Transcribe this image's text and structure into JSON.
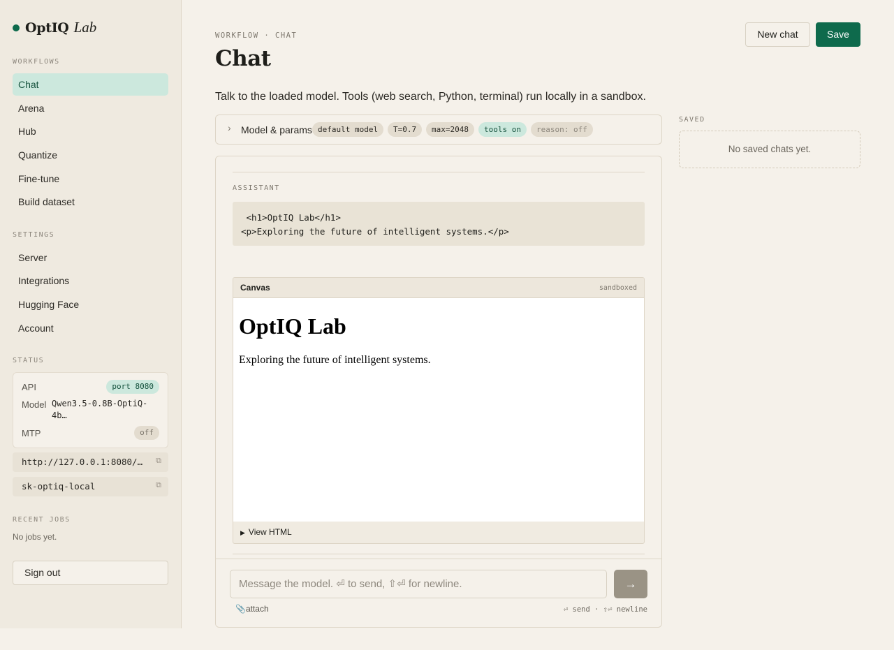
{
  "brand": {
    "name": "OptIQ",
    "suffix": "Lab"
  },
  "sidebar": {
    "workflows_label": "WORKFLOWS",
    "workflows": [
      {
        "label": "Chat"
      },
      {
        "label": "Arena"
      },
      {
        "label": "Hub"
      },
      {
        "label": "Quantize"
      },
      {
        "label": "Fine-tune"
      },
      {
        "label": "Build dataset"
      }
    ],
    "settings_label": "SETTINGS",
    "settings": [
      {
        "label": "Server"
      },
      {
        "label": "Integrations"
      },
      {
        "label": "Hugging Face"
      },
      {
        "label": "Account"
      }
    ],
    "status_label": "STATUS",
    "status": {
      "api_label": "API",
      "api_value": "port 8080",
      "model_label": "Model",
      "model_value": "Qwen3.5-0.8B-OptiQ-4b…",
      "mtp_label": "MTP",
      "mtp_value": "off"
    },
    "endpoint": "http://127.0.0.1:8080/…",
    "api_key": "sk-optiq-local",
    "recent_jobs_label": "RECENT JOBS",
    "recent_jobs_empty": "No jobs yet.",
    "sign_out": "Sign out"
  },
  "header": {
    "breadcrumb": "WORKFLOW · CHAT",
    "title": "Chat",
    "new_chat": "New chat",
    "save": "Save",
    "description": "Talk to the loaded model. Tools (web search, Python, terminal) run locally in a sandbox."
  },
  "params": {
    "chevron": "›",
    "label": "Model & params",
    "tags": [
      "default model",
      "T=0.7",
      "max=2048",
      "tools on",
      "reason: off"
    ]
  },
  "saved": {
    "label": "SAVED",
    "empty": "No saved chats yet."
  },
  "message": {
    "role": "ASSISTANT",
    "code_line1": " <h1>OptIQ Lab</h1>",
    "code_line2": "<p>Exploring the future of intelligent systems.</p>"
  },
  "canvas": {
    "title": "Canvas",
    "tag": "sandboxed",
    "h1": "OptIQ Lab",
    "p": "Exploring the future of intelligent systems.",
    "view_html": "View HTML"
  },
  "composer": {
    "placeholder": "Message the model. ⏎ to send, ⇧⏎ for newline.",
    "send": "→",
    "attach": "attach",
    "hint": "⏎ send · ⇧⏎ newline"
  },
  "colors": {
    "accent": "#0e6a4c",
    "background": "#f5f1ea",
    "sidebar": "#efeae0",
    "pill_green": "#cce8dd"
  }
}
